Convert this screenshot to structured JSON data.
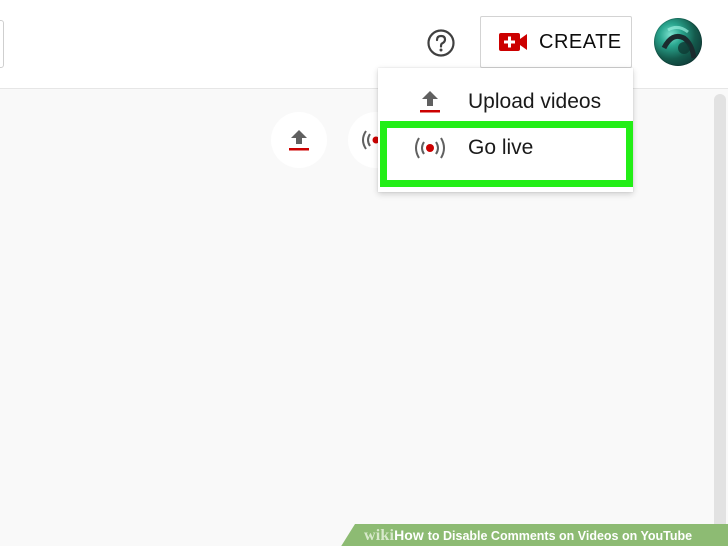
{
  "header": {
    "create_label": "CREATE",
    "help_icon": "question-circle-icon",
    "create_icon": "video-camera-plus-icon",
    "avatar_icon": "user-avatar"
  },
  "menu": {
    "items": [
      {
        "label": "Upload videos",
        "icon": "upload-icon"
      },
      {
        "label": "Go live",
        "icon": "broadcast-icon"
      }
    ],
    "highlighted_item": "Go live"
  },
  "background_buttons": [
    {
      "icon": "upload-icon"
    },
    {
      "icon": "broadcast-icon"
    }
  ],
  "watermark": {
    "wiki": "wiki",
    "how": "How",
    "title": "to Disable Comments on Videos on YouTube"
  },
  "colors": {
    "accent_red": "#cc0000",
    "highlight_green": "#22ee16",
    "watermark_green": "#8dbb73"
  }
}
